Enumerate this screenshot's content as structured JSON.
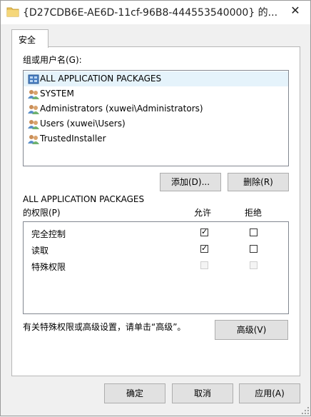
{
  "window": {
    "title": "{D27CDB6E-AE6D-11cf-96B8-444553540000} 的...",
    "close_glyph": "✕"
  },
  "tabs": [
    {
      "label": "安全"
    }
  ],
  "groups": {
    "label": "组或用户名(G):",
    "items": [
      {
        "name": "ALL APPLICATION PACKAGES",
        "icon": "app-packages-icon",
        "selected": true
      },
      {
        "name": "SYSTEM",
        "icon": "users-icon",
        "selected": false
      },
      {
        "name": "Administrators (xuwei\\Administrators)",
        "icon": "users-icon",
        "selected": false
      },
      {
        "name": "Users (xuwei\\Users)",
        "icon": "users-icon",
        "selected": false
      },
      {
        "name": "TrustedInstaller",
        "icon": "users-icon",
        "selected": false
      }
    ]
  },
  "buttons": {
    "add": "添加(D)...",
    "remove": "删除(R)",
    "advanced": "高级(V)",
    "ok": "确定",
    "cancel": "取消",
    "apply": "应用(A)"
  },
  "permissions": {
    "subject": "ALL APPLICATION PACKAGES",
    "label": "的权限(P)",
    "allow_header": "允许",
    "deny_header": "拒绝",
    "rows": [
      {
        "name": "完全控制",
        "allow": true,
        "deny": false,
        "disabled": false
      },
      {
        "name": "读取",
        "allow": true,
        "deny": false,
        "disabled": false
      },
      {
        "name": "特殊权限",
        "allow": false,
        "deny": false,
        "disabled": true
      }
    ]
  },
  "advanced_hint": "有关特殊权限或高级设置，请单击“高级”。",
  "colors": {
    "selection": "#e5f3fb",
    "button_face": "#e1e1e1",
    "panel_border": "#b7b7b7"
  }
}
